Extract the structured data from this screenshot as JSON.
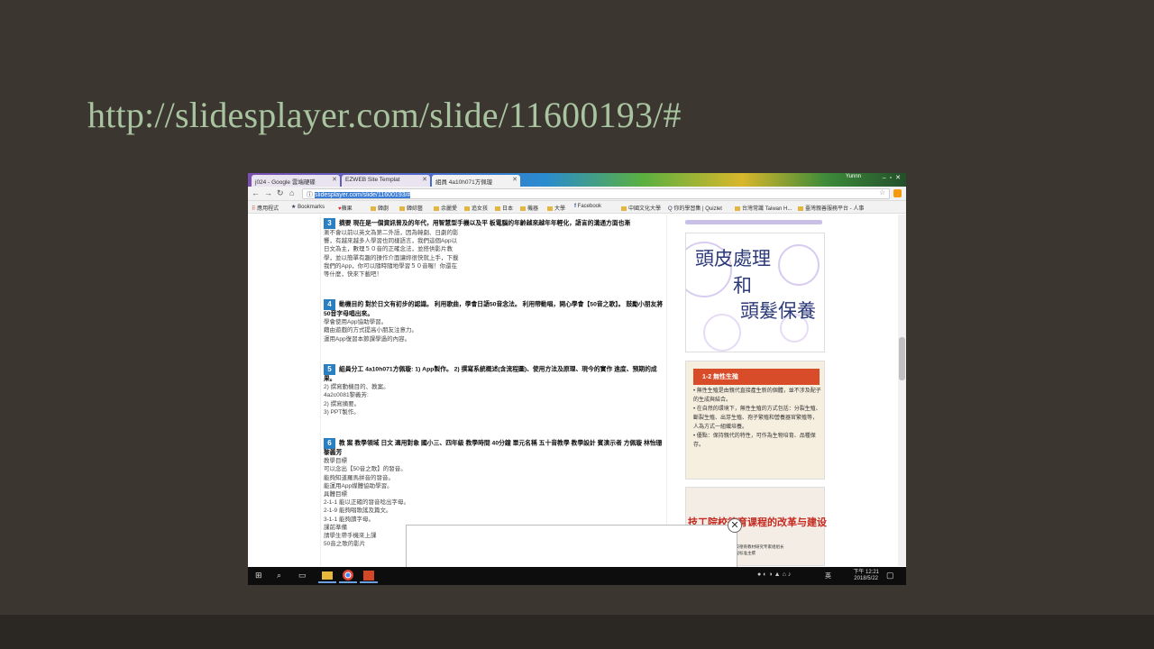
{
  "slide": {
    "title": "http://slidesplayer.com/slide/11600193/#"
  },
  "browser": {
    "tabs": [
      {
        "label": "j024 - Google 雲端硬碟"
      },
      {
        "label": "EZWEB Site Templat"
      },
      {
        "label": "組員 4a10h071方佩璇"
      }
    ],
    "user": "Yunnn",
    "address": "slidesplayer.com/slide/11600193/#",
    "bookmarks": [
      "應用程式",
      "Bookmarks",
      "蘋果",
      "韓劇",
      "韓綜藝",
      "余麗愛",
      "追女孩",
      "日本",
      "機器",
      "大學",
      "Facebook",
      "中國文化大學",
      "你的學習集 | Quizlet",
      "台灣常識 Taiwan H...",
      "臺灣親善服務平台 - 人事"
    ]
  },
  "content": {
    "sections": [
      {
        "num": "3",
        "heading": "摘要 現在是一個資訊普及的年代，用智慧型手機以及平 板電腦的年齡越來越年年輕化，語言的溝通方面也漸",
        "lines": [
          "漸不會以前以英文為第二外語，因為韓劇、日劇的影",
          "響，有越來越多人學習也同樣語言，我們這個App以",
          "日文為主，數理５０音的正確念法，並搭供影片教",
          "學，並以簡單有趣的操作介面讓妳很快就上手，下載",
          "我們的App，你可以隨時隨地學習５０音喔！你還在",
          "等什麼，快來下載吧！"
        ]
      },
      {
        "num": "4",
        "heading": "動機目的 對於日文有初步的認識。 利用歌曲，學會日語50音念法。 利用帶動唱，開心學會【50音之歌】。 鼓勵小朋友將50音字母唱出來。",
        "lines": [
          "學會使用App協助學習。",
          "藉由遊戲的方式提高小朋友注意力。",
          "運用App復習本節課學過的內容。"
        ]
      },
      {
        "num": "5",
        "heading": "組員分工 4a10h071方佩璇: 1) App製作。 2) 撰寫系統概述(含流程圖)、使用方法及原理、現今的實作 進度、預期的成果。",
        "lines": [
          "2) 撰寫動機目的、教案。",
          "4a2c0081黎義芳:",
          "2) 撰寫摘要。",
          "3) PPT製作。"
        ]
      },
      {
        "num": "6",
        "heading": "教 案 教學領域 日文 適用對象 國小三、四年級 教學時間 40分鐘 單元名稱 五十音教學 教學設計 賓演示者 方佩璇 林怡珊 黎義芳",
        "lines": [
          "教學目標",
          "可以念出【50音之歌】的發音。",
          "能夠知道羅馬拼音的發音。",
          "能運用App媒體協助學習。",
          "具體目標",
          "2-1-1 能以正確的發音唸出字母。",
          "2-1-9 能夠唱歌謠及篇文。",
          "3-1-1 能夠讀字母。",
          "課前準備",
          "請學生帶手機來上課",
          "50音之歌的影片"
        ]
      }
    ]
  },
  "sidebar": {
    "card1": {
      "line1": "頭皮處理",
      "line2": "和",
      "line3": "頭髮保養"
    },
    "card2": {
      "heading": "1-2 無性生殖",
      "bullets": [
        "無性生殖是由親代直接產生新的個體，並不涉及配子的生成與結合。",
        "在自然的環境下，無性生殖的方式包括：分裂生殖、斷裂生殖、出芽生殖、孢子繁殖和營養器官繁殖等，人為方式一組織培養。",
        "優點：保持親代的特性，可作為生物培育、品種保存。"
      ]
    },
    "card3": {
      "title": "技工院校德育课程的改革与建设",
      "sub1": "全国中等职业技术学校德育教材研究专家组组长",
      "sub2": "全国技工院校德育课程标准主撰"
    }
  },
  "taskbar": {
    "ime": "英",
    "time": "下午 12:21",
    "date": "2018/5/22"
  }
}
